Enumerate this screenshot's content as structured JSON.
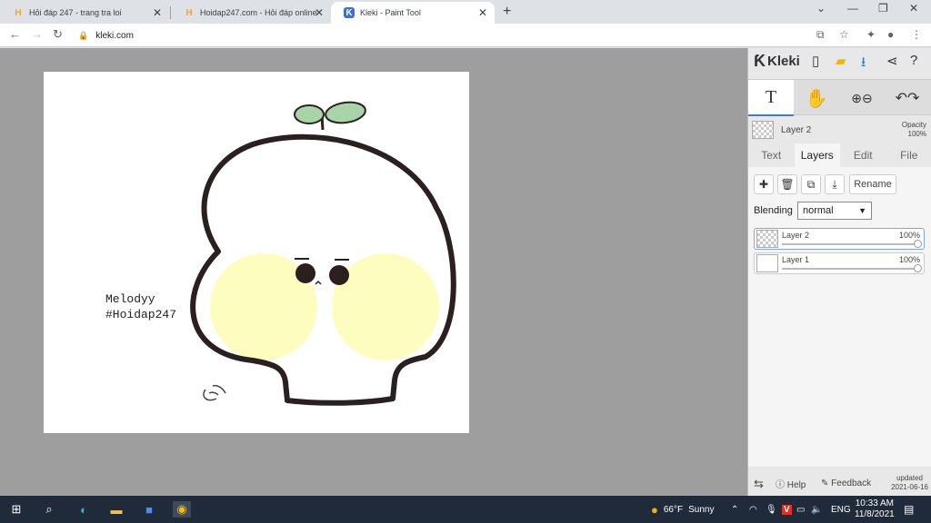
{
  "browser": {
    "tabs": [
      {
        "title": "Hỏi đáp 247 - trang tra loi",
        "active": false
      },
      {
        "title": "Hoidap247.com - Hỏi đáp online",
        "active": false
      },
      {
        "title": "Kleki - Paint Tool",
        "active": true
      }
    ],
    "new_tab": "+",
    "address": "kleki.com"
  },
  "canvas": {
    "text_line1": "Melodyy",
    "text_line2": "#Hoidap247"
  },
  "panel": {
    "logo": "Kleki",
    "current_layer": "Layer 2",
    "opacity_label": "Opacity",
    "opacity_value": "100%",
    "tabs": [
      "Text",
      "Layers",
      "Edit",
      "File"
    ],
    "rename_label": "Rename",
    "blending_label": "Blending",
    "blending_value": "normal",
    "layers": [
      {
        "name": "Layer 2",
        "opacity": "100%"
      },
      {
        "name": "Layer 1",
        "opacity": "100%"
      }
    ],
    "help_label": "Help",
    "feedback_label": "Feedback",
    "updated_label": "updated",
    "updated_date": "2021-06-16"
  },
  "taskbar": {
    "temperature": "66°F",
    "weather": "Sunny",
    "lang": "ENG",
    "time": "10:33 AM",
    "date": "11/8/2021"
  },
  "colors": {
    "accent": "#3a7bd5",
    "cheek": "#fdfdbf",
    "leaf": "#a8d5a8"
  }
}
